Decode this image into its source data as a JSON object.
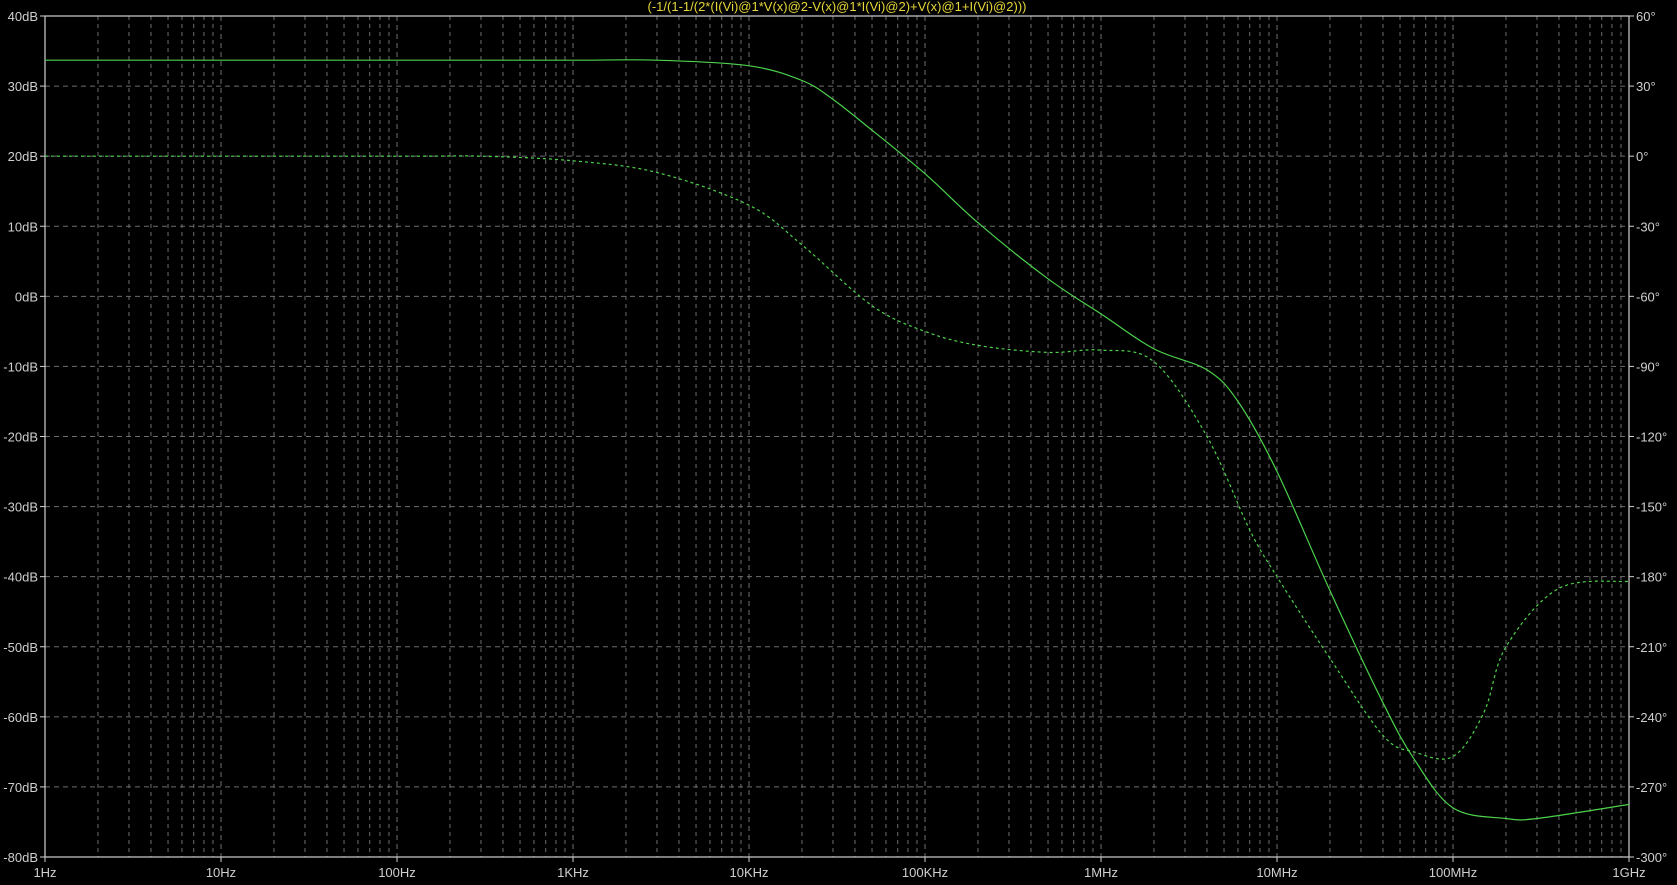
{
  "chart_data": {
    "type": "line",
    "title": "(-1/(1-1/(2*(I(Vi)@1*V(x)@2-V(x)@1*I(Vi)@2)+V(x)@1+I(Vi)@2)))",
    "xscale": "log",
    "xlim_hz": [
      1,
      1000000000
    ],
    "x_ticks": [
      {
        "value": 1,
        "label": "1Hz"
      },
      {
        "value": 10,
        "label": "10Hz"
      },
      {
        "value": 100,
        "label": "100Hz"
      },
      {
        "value": 1000,
        "label": "1KHz"
      },
      {
        "value": 10000,
        "label": "10KHz"
      },
      {
        "value": 100000,
        "label": "100KHz"
      },
      {
        "value": 1000000,
        "label": "1MHz"
      },
      {
        "value": 10000000,
        "label": "10MHz"
      },
      {
        "value": 100000000,
        "label": "100MHz"
      },
      {
        "value": 1000000000,
        "label": "1GHz"
      }
    ],
    "ylim_db": [
      -80,
      40
    ],
    "y_left_ticks": [
      "40dB",
      "30dB",
      "20dB",
      "10dB",
      "0dB",
      "-10dB",
      "-20dB",
      "-30dB",
      "-40dB",
      "-50dB",
      "-60dB",
      "-70dB",
      "-80dB"
    ],
    "y_left_values": [
      40,
      30,
      20,
      10,
      0,
      -10,
      -20,
      -30,
      -40,
      -50,
      -60,
      -70,
      -80
    ],
    "ylim_deg": [
      -300,
      60
    ],
    "y_right_ticks": [
      "60°",
      "30°",
      "0°",
      "-30°",
      "-60°",
      "-90°",
      "-120°",
      "-150°",
      "-180°",
      "-210°",
      "-240°",
      "-270°",
      "-300°"
    ],
    "y_right_values": [
      60,
      30,
      0,
      -30,
      -60,
      -90,
      -120,
      -150,
      -180,
      -210,
      -240,
      -270,
      -300
    ],
    "grid": true,
    "colors": {
      "background": "#000000",
      "trace": "#4cd24c",
      "grid": "#6e6e6e",
      "title": "#e6d63a",
      "axis": "#d0d0d0"
    },
    "series": [
      {
        "axis": "left",
        "style": "solid",
        "x": [
          1,
          100,
          1000,
          3000,
          10000,
          20000,
          30000,
          50000,
          100000,
          200000,
          500000,
          1000000,
          2000000,
          4000000,
          6000000,
          10000000,
          20000000,
          40000000,
          60000000,
          100000000,
          200000000,
          300000000,
          1000000000
        ],
        "y": [
          33.7,
          33.7,
          33.7,
          33.7,
          32.9,
          30.8,
          28.1,
          23.7,
          17.5,
          10.5,
          2.5,
          -2.5,
          -7.5,
          -10.5,
          -15,
          -25,
          -42,
          -58,
          -66,
          -73,
          -74.5,
          -74.5,
          -72.5
        ]
      },
      {
        "axis": "right",
        "style": "dashed",
        "x": [
          1,
          100,
          300,
          1000,
          3000,
          10000,
          20000,
          50000,
          100000,
          200000,
          500000,
          1000000,
          2000000,
          4000000,
          7000000,
          10000000,
          20000000,
          40000000,
          60000000,
          100000000,
          150000000,
          200000000,
          400000000,
          1000000000
        ],
        "y": [
          0,
          0,
          0,
          -2,
          -7,
          -21,
          -38,
          -64,
          -75,
          -81,
          -84,
          -83,
          -88,
          -120,
          -160,
          -180,
          -215,
          -248,
          -255,
          -257,
          -238,
          -210,
          -185,
          -182
        ]
      }
    ]
  }
}
